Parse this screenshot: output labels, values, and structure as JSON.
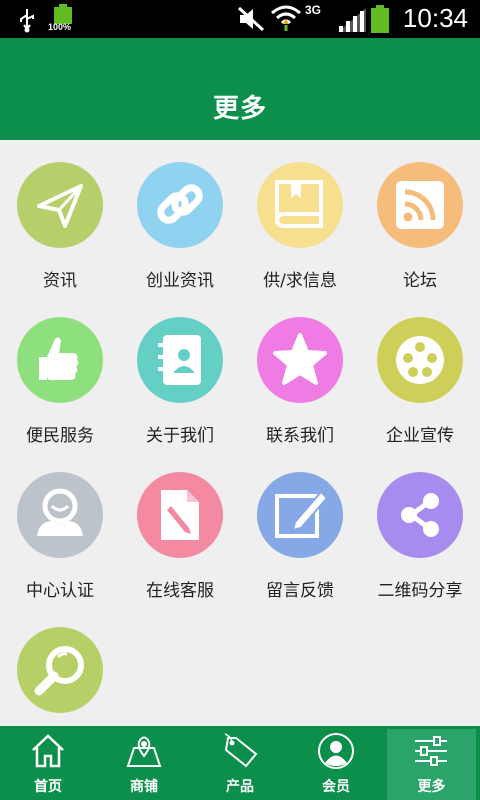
{
  "status_bar": {
    "battery_percent": "100%",
    "network": "3G",
    "time": "10:34"
  },
  "header": {
    "title": "更多"
  },
  "grid": {
    "items": [
      {
        "label": "资讯",
        "icon": "paper-plane-icon",
        "color": "#b7cf6b"
      },
      {
        "label": "创业资讯",
        "icon": "chain-link-icon",
        "color": "#8fd3f0"
      },
      {
        "label": "供/求信息",
        "icon": "book-icon",
        "color": "#f6e08f"
      },
      {
        "label": "论坛",
        "icon": "rss-icon",
        "color": "#f6bc7c"
      },
      {
        "label": "便民服务",
        "icon": "thumbs-up-icon",
        "color": "#8ee07f"
      },
      {
        "label": "关于我们",
        "icon": "contacts-book-icon",
        "color": "#64cfc4"
      },
      {
        "label": "联系我们",
        "icon": "star-icon",
        "color": "#ef7ce4"
      },
      {
        "label": "企业宣传",
        "icon": "film-reel-icon",
        "color": "#cdcf59"
      },
      {
        "label": "中心认证",
        "icon": "user-icon",
        "color": "#bdc3cb"
      },
      {
        "label": "在线客服",
        "icon": "document-pencil-icon",
        "color": "#f38aa2"
      },
      {
        "label": "留言反馈",
        "icon": "edit-note-icon",
        "color": "#86a8e6"
      },
      {
        "label": "二维码分享",
        "icon": "share-icon",
        "color": "#a78cf0"
      },
      {
        "label": "",
        "icon": "magnifier-icon",
        "color": "#b6cf66"
      }
    ]
  },
  "tab_bar": {
    "tabs": [
      {
        "label": "首页",
        "icon": "home-icon"
      },
      {
        "label": "商铺",
        "icon": "map-store-icon"
      },
      {
        "label": "产品",
        "icon": "sale-tag-icon"
      },
      {
        "label": "会员",
        "icon": "member-avatar-icon"
      },
      {
        "label": "更多",
        "icon": "sliders-icon"
      }
    ],
    "active": "更多"
  }
}
